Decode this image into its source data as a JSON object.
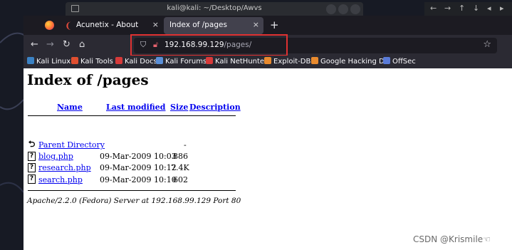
{
  "terminal": {
    "title": "kali@kali: ~/Desktop/Awvs"
  },
  "browser": {
    "tabs": [
      {
        "label": "Acunetix - About",
        "active": false,
        "icon": "acunetix-icon"
      },
      {
        "label": "Index of /pages",
        "active": true,
        "icon": ""
      }
    ],
    "new_tab": "+",
    "close_glyph": "×",
    "url": {
      "host": "192.168.99.129",
      "path": "/pages/"
    },
    "bookmarks": [
      {
        "label": "Kali Linux",
        "icon": "kali-icon",
        "color": "#3b82c4"
      },
      {
        "label": "Kali Tools",
        "icon": "kali-tools-icon",
        "color": "#e04f30"
      },
      {
        "label": "Kali Docs",
        "icon": "kali-docs-icon",
        "color": "#d63a3a"
      },
      {
        "label": "Kali Forums",
        "icon": "kali-forums-icon",
        "color": "#5a8fd8"
      },
      {
        "label": "Kali NetHunter",
        "icon": "nethunter-icon",
        "color": "#d83a3a"
      },
      {
        "label": "Exploit-DB",
        "icon": "exploit-db-icon",
        "color": "#e88a2e"
      },
      {
        "label": "Google Hacking DB",
        "icon": "ghdb-icon",
        "color": "#e88a2e"
      },
      {
        "label": "OffSec",
        "icon": "offsec-icon",
        "color": "#5a7bd8"
      }
    ]
  },
  "page": {
    "title": "Index of /pages",
    "columns": {
      "name": "Name",
      "modified": "Last modified",
      "size": "Size",
      "description": "Description"
    },
    "rows": [
      {
        "name": "Parent Directory",
        "modified": "",
        "size": "-",
        "icon": "back-icon"
      },
      {
        "name": "blog.php",
        "modified": "09-Mar-2009 10:03",
        "size": "886",
        "icon": "file-icon"
      },
      {
        "name": "research.php",
        "modified": "09-Mar-2009 10:12",
        "size": "7.4K",
        "icon": "file-icon"
      },
      {
        "name": "search.php",
        "modified": "09-Mar-2009 10:10",
        "size": "602",
        "icon": "file-icon"
      }
    ],
    "address": "Apache/2.2.0 (Fedora) Server at 192.168.99.129 Port 80"
  },
  "watermark": "CSDN @Krismile☜"
}
